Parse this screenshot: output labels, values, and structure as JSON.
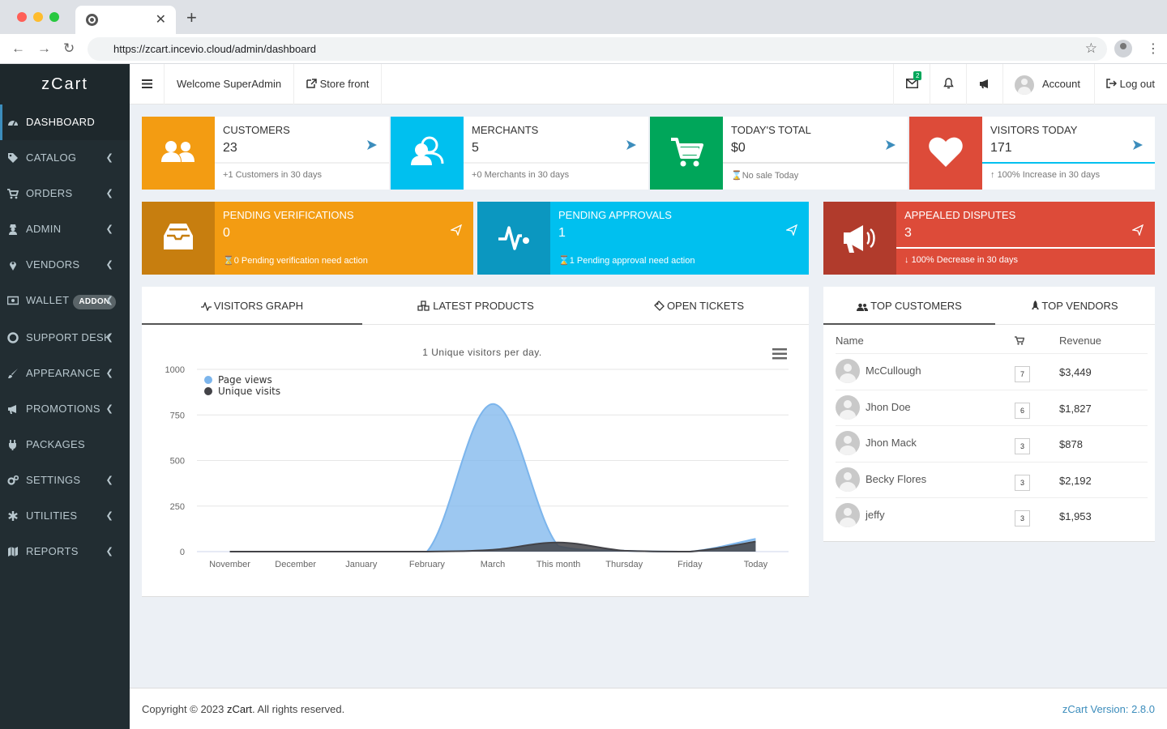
{
  "browser": {
    "url": "https://zcart.incevio.cloud/admin/dashboard"
  },
  "sidebar": {
    "logo": "zCart",
    "items": [
      {
        "label": "DASHBOARD",
        "icon": "dashboard-icon"
      },
      {
        "label": "CATALOG",
        "icon": "tags-icon"
      },
      {
        "label": "ORDERS",
        "icon": "cart-icon"
      },
      {
        "label": "ADMIN",
        "icon": "user-secret-icon"
      },
      {
        "label": "VENDORS",
        "icon": "map-marker-icon"
      },
      {
        "label": "WALLET",
        "icon": "money-icon",
        "badge": "ADDON"
      },
      {
        "label": "SUPPORT DESK",
        "icon": "life-ring-icon"
      },
      {
        "label": "APPEARANCE",
        "icon": "paint-brush-icon"
      },
      {
        "label": "PROMOTIONS",
        "icon": "bullhorn-icon"
      },
      {
        "label": "PACKAGES",
        "icon": "plug-icon"
      },
      {
        "label": "SETTINGS",
        "icon": "cogs-icon"
      },
      {
        "label": "UTILITIES",
        "icon": "asterisk-icon"
      },
      {
        "label": "REPORTS",
        "icon": "map-icon"
      }
    ]
  },
  "header": {
    "welcome": "Welcome SuperAdmin",
    "storefront": "Store front",
    "mail_badge": "2",
    "account": "Account",
    "logout": "Log out"
  },
  "stats": {
    "customers": {
      "title": "CUSTOMERS",
      "value": "23",
      "sub": "1 Customers in 30 days"
    },
    "merchants": {
      "title": "MERCHANTS",
      "value": "5",
      "sub": "0 Merchants in 30 days"
    },
    "today": {
      "title": "TODAY'S TOTAL",
      "value": "$0",
      "sub": "No sale Today"
    },
    "visitors": {
      "title": "VISITORS TODAY",
      "value": "171",
      "sub": "100% Increase in 30 days"
    },
    "pending_verifications": {
      "title": "PENDING VERIFICATIONS",
      "value": "0",
      "sub": "0 Pending verification need action"
    },
    "pending_approvals": {
      "title": "PENDING APPROVALS",
      "value": "1",
      "sub": "1 Pending approval need action"
    },
    "appealed_disputes": {
      "title": "APPEALED DISPUTES",
      "value": "3",
      "sub": "100% Decrease in 30 days"
    }
  },
  "left_tabs": [
    "VISITORS GRAPH",
    "LATEST PRODUCTS",
    "OPEN TICKETS"
  ],
  "right_tabs": [
    "TOP CUSTOMERS",
    "TOP VENDORS"
  ],
  "chart_data": {
    "type": "area",
    "title": "1 Unique visitors per day.",
    "categories": [
      "November",
      "December",
      "January",
      "February",
      "March",
      "This month",
      "Thursday",
      "Friday",
      "Today"
    ],
    "ylim": [
      0,
      1000
    ],
    "yticks": [
      0,
      250,
      500,
      750,
      1000
    ],
    "legend_position": "top-left",
    "series": [
      {
        "name": "Page views",
        "color": "#7cb5ec",
        "values": [
          0,
          0,
          0,
          0,
          810,
          30,
          5,
          0,
          70
        ]
      },
      {
        "name": "Unique visits",
        "color": "#434348",
        "values": [
          0,
          0,
          0,
          0,
          10,
          50,
          5,
          0,
          55
        ]
      }
    ]
  },
  "customers_table": {
    "headers": {
      "name": "Name",
      "revenue": "Revenue"
    },
    "rows": [
      {
        "name": "McCullough",
        "orders": "7",
        "revenue": "$3,449"
      },
      {
        "name": "Jhon Doe",
        "orders": "6",
        "revenue": "$1,827"
      },
      {
        "name": "Jhon Mack",
        "orders": "3",
        "revenue": "$878"
      },
      {
        "name": "Becky Flores",
        "orders": "3",
        "revenue": "$2,192"
      },
      {
        "name": "jeffy",
        "orders": "3",
        "revenue": "$1,953"
      }
    ]
  },
  "footer": {
    "copyright_prefix": "Copyright © 2023 ",
    "brand": "zCart",
    "copyright_suffix": ". All rights reserved.",
    "version": "zCart Version: 2.8.0"
  },
  "colors": {
    "orange": "#f39c12",
    "orange_dark": "#d68910",
    "aqua": "#00c0ef",
    "aqua_dark": "#00a7d0",
    "green": "#00a65a",
    "red": "#dd4b39",
    "red_dark": "#c23d2c",
    "sidebar": "#222d32",
    "link": "#3c8dbc"
  }
}
